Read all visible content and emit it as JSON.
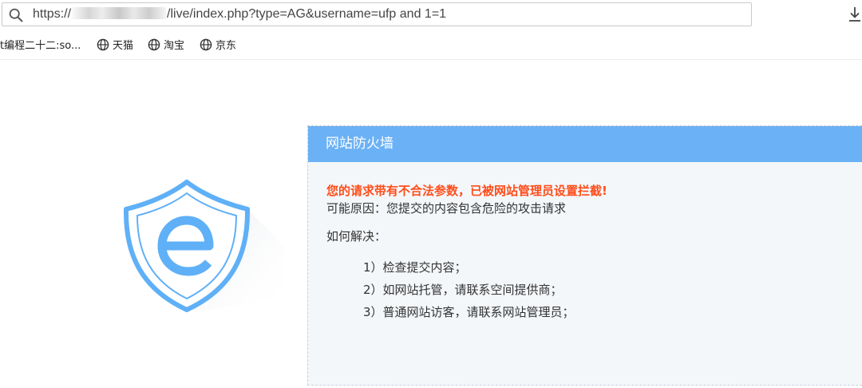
{
  "browser": {
    "url_prefix": "https://",
    "url_suffix": "/live/index.php?type=AG&username=ufp and 1=1",
    "icons": {
      "search": "search-icon",
      "download": "download-icon"
    }
  },
  "bookmarks": [
    {
      "label": "t编程二十二:so...",
      "icon": null
    },
    {
      "label": "天猫",
      "icon": "globe-icon"
    },
    {
      "label": "淘宝",
      "icon": "globe-icon"
    },
    {
      "label": "京东",
      "icon": "globe-icon"
    }
  ],
  "firewall": {
    "title": "网站防火墙",
    "warning": "您的请求带有不合法参数，已被网站管理员设置拦截!",
    "reason": "可能原因：您提交的内容包含危险的攻击请求",
    "how_title": "如何解决：",
    "steps": [
      "1）检查提交内容；",
      "2）如网站托管，请联系空间提供商；",
      "3）普通网站访客，请联系网站管理员；"
    ],
    "colors": {
      "header": "#6bb1f5",
      "warning": "#ff4d1a",
      "panel_bg": "#f4f7fa",
      "logo": "#5fb0f6"
    }
  }
}
